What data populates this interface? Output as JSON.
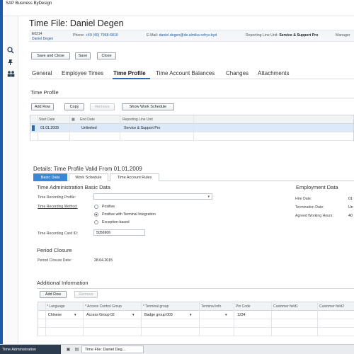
{
  "app": {
    "name": "SAP Business ByDesign",
    "title_prefix": "Time File: ",
    "employee_name": "Daniel Degen"
  },
  "header": {
    "employee_id": "E0214",
    "employee_name": "Daniel Degen",
    "phone_label": "Phone:",
    "phone_value": "+49 (40) 7968-6810",
    "email_label": "E-Mail:",
    "email_value": "daniel.degen@de.almika-refrys.byd",
    "reporting_label": "Reporting Line Unit:",
    "reporting_value": "Service & Support Pro",
    "manager_label": "Manager"
  },
  "toolbar": {
    "save_close": "Save and Close",
    "save": "Save",
    "close": "Close"
  },
  "tabs": [
    {
      "label": "General"
    },
    {
      "label": "Employee Times"
    },
    {
      "label": "Time Profile"
    },
    {
      "label": "Time Account Balances"
    },
    {
      "label": "Changes"
    },
    {
      "label": "Attachments"
    }
  ],
  "time_profile": {
    "title": "Time Profile",
    "buttons": {
      "add_row": "Add Row",
      "copy": "Copy",
      "remove": "Remove",
      "show_schedule": "Show Work Schedule"
    },
    "columns": {
      "start": "Start Date",
      "end": "End Date",
      "unit": "Reporting Line Unit"
    },
    "rows": [
      {
        "start": "01.01.2009",
        "end": "Unlimited",
        "unit": "Service & Support Pro"
      }
    ]
  },
  "details": {
    "title": "Details: Time Profile Valid From 01.01.2009",
    "subtabs": [
      {
        "label": "Basic Data"
      },
      {
        "label": "Work Schedule"
      },
      {
        "label": "Time Account Rules"
      }
    ],
    "basic": {
      "section_title": "Time Administration Basic Data",
      "profile_label": "Time Recording Profile:",
      "profile_value": "",
      "method_label": "Time Recording Method:",
      "methods": [
        "Positive",
        "Positive with Terminal Integration",
        "Exception-based"
      ],
      "card_label": "Time Recording Card ID:",
      "card_value": "5056906"
    },
    "employment": {
      "section_title": "Employment Data",
      "hire_label": "Hire Date:",
      "hire_value": "01",
      "term_label": "Termination Date:",
      "term_value": "Un",
      "hours_label": "Agreed Working Hours:",
      "hours_value": "40"
    },
    "period": {
      "section_title": "Period Closure",
      "date_label": "Period Closure Date:",
      "date_value": "28.04.2015"
    },
    "additional": {
      "section_title": "Additional Information",
      "buttons": {
        "add_row": "Add Row",
        "remove": "Remove"
      },
      "columns": {
        "language": "* Language",
        "access": "* Access Control Group",
        "terminal_group": "* Terminal group",
        "terminal_info": "Terminal info",
        "pin": "Pin Code",
        "field1": "Customer field1",
        "field2": "Customer field2"
      },
      "rows": [
        {
          "language": "Chinese",
          "access": "Access Group 02",
          "terminal_group": "Badge group 003",
          "terminal_info": "",
          "pin": "1234",
          "field1": "",
          "field2": ""
        }
      ]
    }
  },
  "taskbar": {
    "left": "Time Administration",
    "item": "Time File: Daniel Deg..."
  }
}
